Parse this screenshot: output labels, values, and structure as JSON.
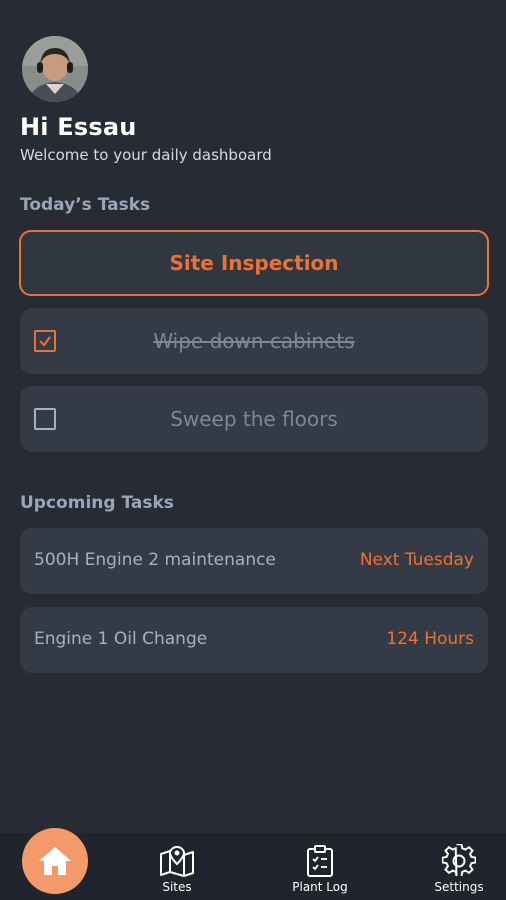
{
  "header": {
    "greeting": "Hi Essau",
    "welcome": "Welcome to your daily dashboard"
  },
  "today": {
    "title": "Today’s Tasks",
    "primary_task": "Site Inspection",
    "tasks": [
      {
        "label": "Wipe down cabinets",
        "checked": true
      },
      {
        "label": "Sweep the floors",
        "checked": false
      }
    ]
  },
  "upcoming": {
    "title": "Upcoming Tasks",
    "items": [
      {
        "name": "500H Engine 2 maintenance",
        "when": "Next Tuesday"
      },
      {
        "name": "Engine 1 Oil Change",
        "when": "124 Hours"
      }
    ]
  },
  "nav": {
    "home_icon": "home-icon",
    "items": [
      {
        "label": "Sites",
        "icon": "map-icon"
      },
      {
        "label": "Plant Log",
        "icon": "clipboard-icon"
      },
      {
        "label": "Settings",
        "icon": "gear-icon"
      }
    ]
  },
  "colors": {
    "accent": "#ef7132",
    "background": "#262b34",
    "card": "#353b46",
    "nav_background": "#20242c",
    "home_button": "#f49a6a"
  }
}
